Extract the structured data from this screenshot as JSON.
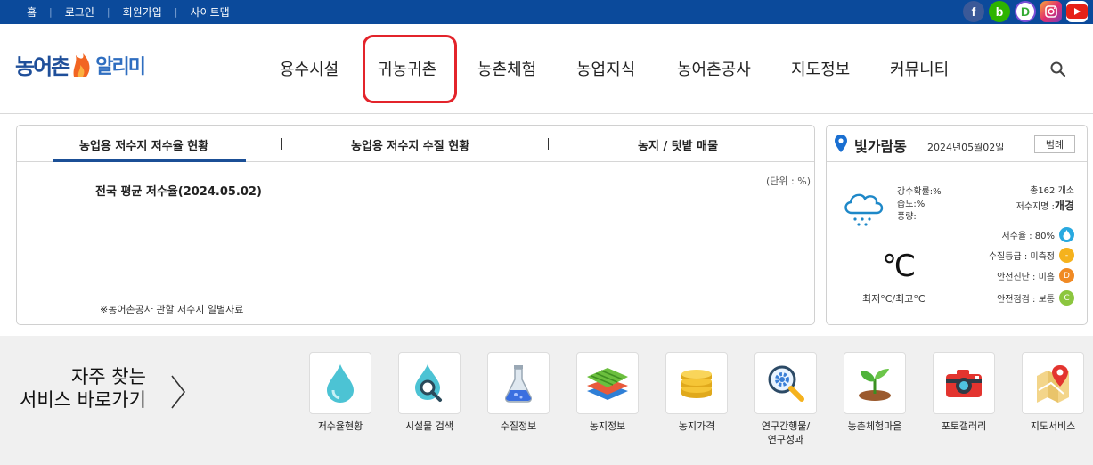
{
  "topbar": {
    "links": [
      "홈",
      "로그인",
      "회원가입",
      "사이트맵"
    ],
    "social": {
      "facebook": "f",
      "blog": "b",
      "band": "D"
    },
    "colors": {
      "bar": "#0b4a9b"
    }
  },
  "header": {
    "logo_left": "농어촌",
    "logo_right": "알리미",
    "menu": [
      "용수시설",
      "귀농귀촌",
      "농촌체험",
      "농업지식",
      "농어촌공사",
      "지도정보",
      "커뮤니티"
    ]
  },
  "reservoir": {
    "tabs": [
      "농업용 저수지 저수율 현황",
      "농업용 저수지 수질 현황",
      "농지 / 텃밭 매물"
    ],
    "unit": "(단위 : %)",
    "avg_title": "전국 평균 저수율(2024.05.02)",
    "note": "※농어촌공사 관할 저수지 일별자료"
  },
  "weather": {
    "place": "빛가람동",
    "date": "2024년05월02일",
    "range_button": "범례",
    "rain_prob": "강수확률:%",
    "humidity": "습도:%",
    "rainfall": "풍량:",
    "temp": "℃",
    "minmax": "최저°C/최고°C",
    "total": "총162 개소",
    "name_label": "저수지명 : ",
    "name_value": "개경",
    "rate": "저수율 : 80%",
    "quality": "수질등급 : 미측정",
    "safety_diag": "안전진단 : 미흡",
    "safety_check": "안전점검 : 보통",
    "quality_badge": "-",
    "diag_badge": "D",
    "check_badge": "C"
  },
  "quick": {
    "title_line1": "자주 찾는",
    "title_line2": "서비스 바로가기",
    "services": [
      {
        "label": "저수율현황"
      },
      {
        "label": "시설물 검색"
      },
      {
        "label": "수질정보"
      },
      {
        "label": "농지정보"
      },
      {
        "label": "농지가격"
      },
      {
        "label": "연구간행물/\n연구성과"
      },
      {
        "label": "농촌체험마을"
      },
      {
        "label": "포토갤러리"
      },
      {
        "label": "지도서비스"
      }
    ]
  }
}
